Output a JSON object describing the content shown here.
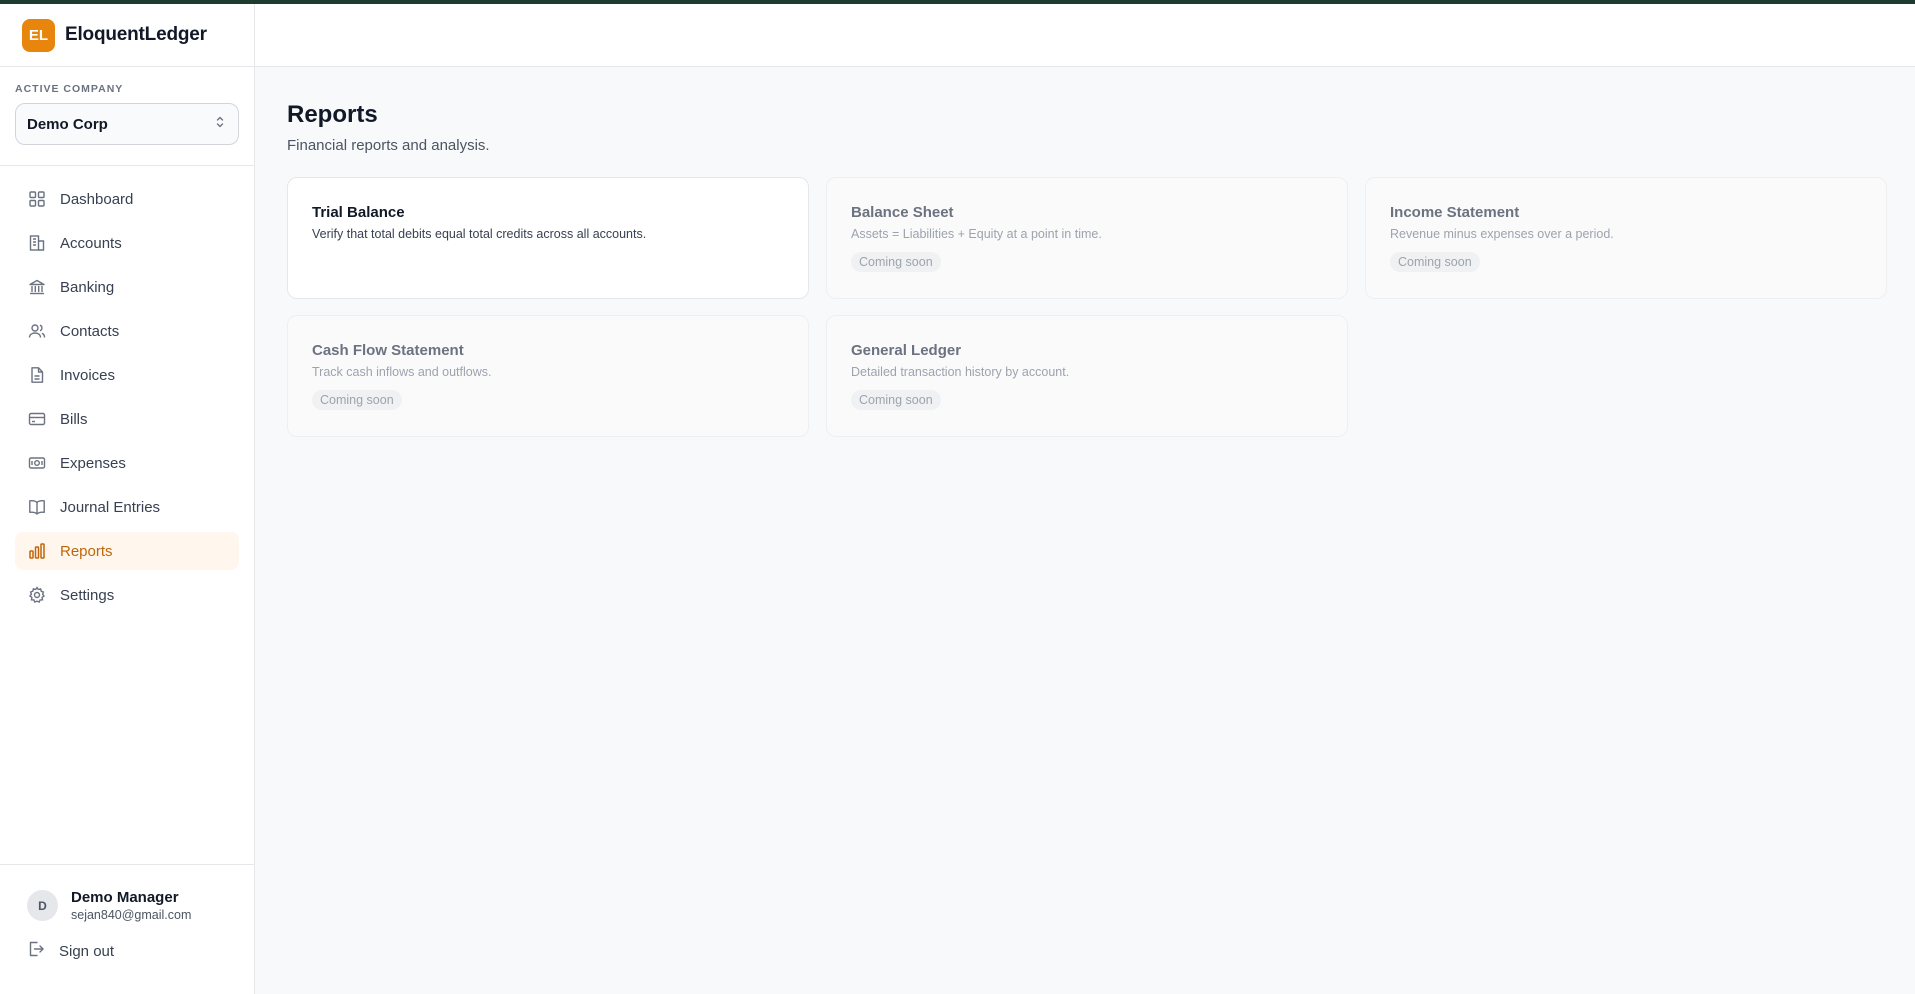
{
  "app": {
    "logo_initials": "EL",
    "name": "EloquentLedger",
    "accent_color": "#e8850c"
  },
  "company": {
    "label": "ACTIVE COMPANY",
    "selected": "Demo Corp"
  },
  "nav": {
    "items": [
      {
        "label": "Dashboard",
        "icon": "grid-icon"
      },
      {
        "label": "Accounts",
        "icon": "building-icon"
      },
      {
        "label": "Banking",
        "icon": "bank-icon"
      },
      {
        "label": "Contacts",
        "icon": "users-icon"
      },
      {
        "label": "Invoices",
        "icon": "file-icon"
      },
      {
        "label": "Bills",
        "icon": "credit-card-icon"
      },
      {
        "label": "Expenses",
        "icon": "banknote-icon"
      },
      {
        "label": "Journal Entries",
        "icon": "book-icon"
      },
      {
        "label": "Reports",
        "icon": "bar-chart-icon",
        "active": true
      },
      {
        "label": "Settings",
        "icon": "gear-icon"
      }
    ]
  },
  "user": {
    "initial": "D",
    "name": "Demo Manager",
    "email": "sejan840@gmail.com",
    "signout_label": "Sign out"
  },
  "page": {
    "title": "Reports",
    "subtitle": "Financial reports and analysis."
  },
  "reports": [
    {
      "title": "Trial Balance",
      "description": "Verify that total debits equal total credits across all accounts.",
      "available": true
    },
    {
      "title": "Balance Sheet",
      "description": "Assets = Liabilities + Equity at a point in time.",
      "badge": "Coming soon"
    },
    {
      "title": "Income Statement",
      "description": "Revenue minus expenses over a period.",
      "badge": "Coming soon"
    },
    {
      "title": "Cash Flow Statement",
      "description": "Track cash inflows and outflows.",
      "badge": "Coming soon"
    },
    {
      "title": "General Ledger",
      "description": "Detailed transaction history by account.",
      "badge": "Coming soon"
    }
  ]
}
